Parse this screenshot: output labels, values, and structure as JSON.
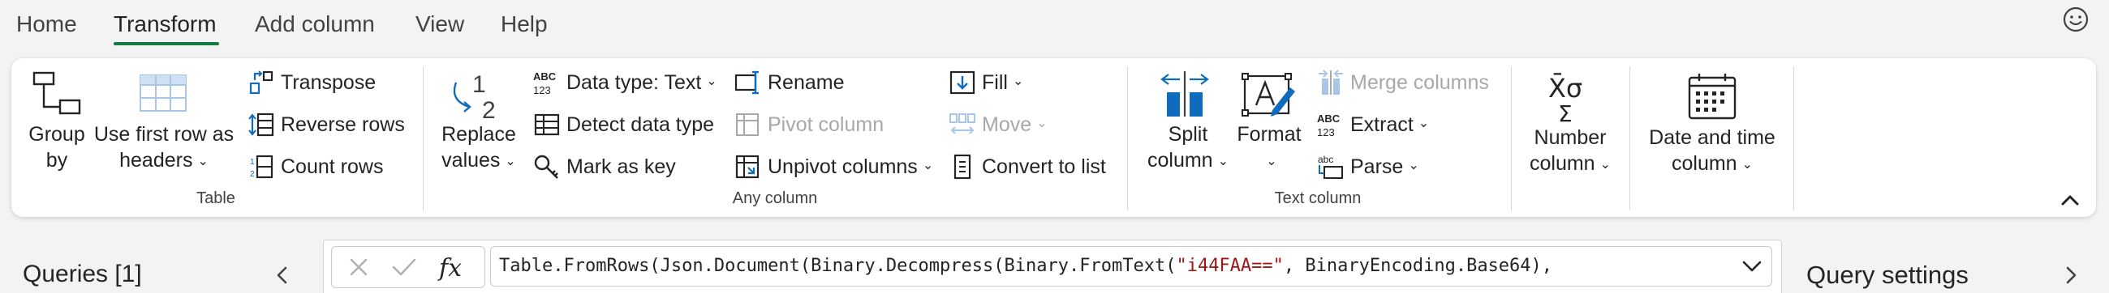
{
  "menu": {
    "tabs": [
      "Home",
      "Transform",
      "Add column",
      "View",
      "Help"
    ],
    "active": "Transform"
  },
  "ribbon": {
    "table_group": {
      "label": "Table",
      "group_by": [
        "Group",
        "by"
      ],
      "use_first_row": [
        "Use first row as",
        "headers"
      ],
      "transpose": "Transpose",
      "reverse_rows": "Reverse rows",
      "count_rows": "Count rows"
    },
    "any_column_group": {
      "label": "Any column",
      "replace_values": [
        "Replace",
        "values"
      ],
      "data_type": "Data type: Text",
      "detect_data_type": "Detect data type",
      "mark_as_key": "Mark as key",
      "rename": "Rename",
      "pivot_column": "Pivot column",
      "unpivot_columns": "Unpivot columns",
      "fill": "Fill",
      "move": "Move",
      "convert_to_list": "Convert to list"
    },
    "text_column_group": {
      "label": "Text column",
      "split_column": [
        "Split",
        "column"
      ],
      "format": "Format",
      "merge_columns": "Merge columns",
      "extract": "Extract",
      "parse": "Parse"
    },
    "number_column": [
      "Number",
      "column"
    ],
    "date_time_column": [
      "Date and time",
      "column"
    ]
  },
  "icons": {
    "abc123_top": "ABC",
    "abc123_bottom": "123",
    "abc_small": "abc",
    "one": "1",
    "two": "2",
    "sigma_top": "X̄σ",
    "sigma_bottom": "Σ",
    "fx": "fx"
  },
  "queries": {
    "label": "Queries [1]"
  },
  "formula": {
    "prefix": "Table.FromRows(Json.Document(Binary.Decompress(Binary.FromText(",
    "string": "\"i44FAA==\"",
    "suffix": ", BinaryEncoding.Base64),"
  },
  "query_settings": {
    "label": "Query settings"
  },
  "colors": {
    "accent": "#107c41",
    "icon_blue": "#0f6cbd",
    "disabled": "#a8a8a8"
  }
}
